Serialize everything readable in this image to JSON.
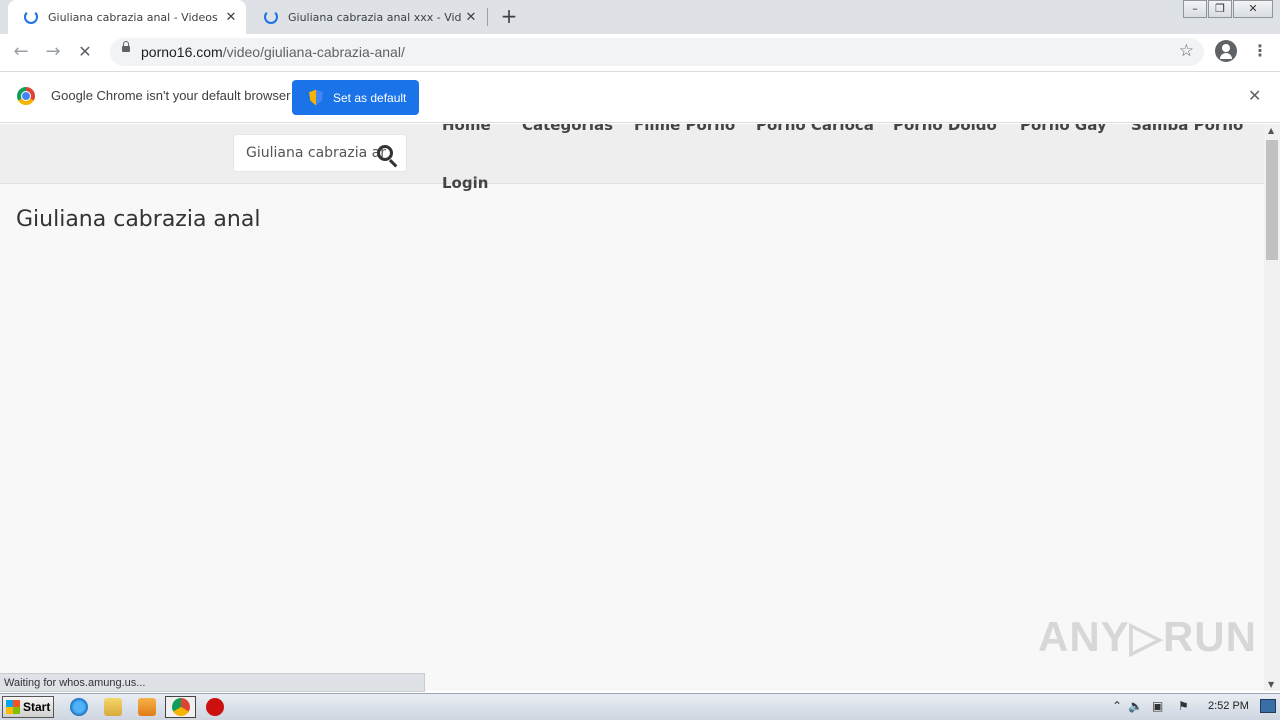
{
  "tabs": [
    {
      "title": "Giuliana cabrazia anal - Videos Xxx |",
      "close": "✕"
    },
    {
      "title": "Giuliana cabrazia anal xxx - Videos X",
      "close": "✕"
    }
  ],
  "new_tab": "+",
  "window_controls": {
    "minimize": "–",
    "restore": "❐",
    "close": "✕"
  },
  "toolbar": {
    "back": "←",
    "forward": "→",
    "reload": "✕",
    "url_host": "porno16.com",
    "url_path": "/video/giuliana-cabrazia-anal/",
    "star": "☆",
    "menu": "⋮"
  },
  "infobar": {
    "message": "Google Chrome isn't your default browser",
    "button": "Set as default",
    "close": "✕"
  },
  "site": {
    "search_value": "Giuliana cabrazia anal",
    "nav": [
      "Home",
      "Categorias",
      "Filme Porno",
      "Porno Carioca",
      "Porno Doido",
      "Porno Gay",
      "Samba Porno",
      "Login"
    ],
    "page_title": "Giuliana cabrazia anal"
  },
  "status_text": "Waiting for whos.amung.us...",
  "watermark": "ANY▷RUN",
  "taskbar": {
    "start": "Start",
    "clock": "2:52 PM"
  }
}
